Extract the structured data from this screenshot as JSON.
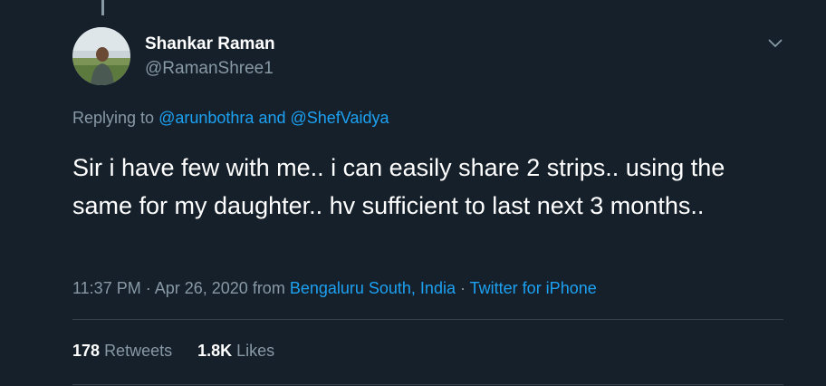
{
  "tweet": {
    "author": {
      "display_name": "Shankar Raman",
      "handle": "@RamanShree1"
    },
    "replying_to": {
      "prefix": "Replying to",
      "mention_1": "@arunbothra",
      "conjunction": "and",
      "mention_2": "@ShefVaidya"
    },
    "text": "Sir i have few with me.. i can easily share 2 strips.. using the same for my daughter.. hv sufficient to last next 3 months..",
    "meta": {
      "timestamp": "11:37 PM · Apr 26, 2020",
      "from_label": "from",
      "location": "Bengaluru South, India",
      "separator": "·",
      "source": "Twitter for iPhone"
    },
    "stats": {
      "retweets_count": "178",
      "retweets_label": "Retweets",
      "likes_count": "1.8K",
      "likes_label": "Likes"
    }
  },
  "icons": {
    "caret": "chevron-down-icon",
    "avatar": "profile-photo"
  },
  "colors": {
    "background": "#15202b",
    "primary_text": "#ffffff",
    "secondary_text": "#8899a6",
    "link": "#1da1f2",
    "divider": "#38444d"
  }
}
